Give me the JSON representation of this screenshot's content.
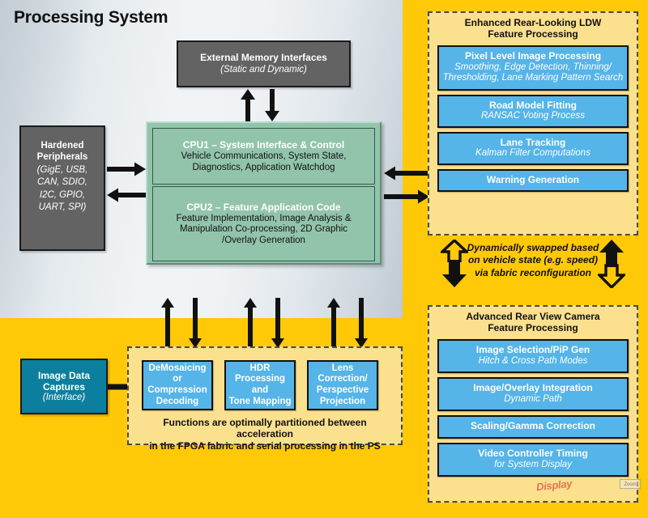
{
  "colors": {
    "accent_yellow": "#ffc907",
    "panel_yellow": "#fbe08d",
    "blue_box": "#55b4e8",
    "teal_box": "#0d7f9e",
    "grey_box": "#636363",
    "cpu_green": "#92c4ac",
    "ps_grey_dark": "#c2ccd5",
    "ps_grey_light": "#f1f4f6"
  },
  "processing_system": {
    "title": "Processing System",
    "external_memory": {
      "title": "External Memory Interfaces",
      "subtitle": "(Static and Dynamic)"
    },
    "hardened_peripherals": {
      "title_line1": "Hardened",
      "title_line2": "Peripherals",
      "subtitle_line1": "(GigE, USB,",
      "subtitle_line2": "CAN, SDIO,",
      "subtitle_line3": "I2C, GPIO,",
      "subtitle_line4": "UART, SPI)"
    },
    "cpu1": {
      "title": "CPU1 – System Interface & Control",
      "detail_line1": "Vehicle Communications, System State,",
      "detail_line2": "Diagnostics, Application Watchdog"
    },
    "cpu2": {
      "title": "CPU2 – Feature Application Code",
      "detail_line1": "Feature Implementation, Image Analysis &",
      "detail_line2": "Manipulation Co-processing, 2D Graphic",
      "detail_line3": "/Overlay Generation"
    }
  },
  "ldw_panel": {
    "title_line1": "Enhanced Rear-Looking LDW",
    "title_line2": "Feature Processing",
    "blocks": [
      {
        "title": "Pixel Level Image Processing",
        "subtitle_line1": "Smoothing, Edge Detection, Thinning/",
        "subtitle_line2": "Thresholding, Lane Marking Pattern Search"
      },
      {
        "title": "Road Model Fitting",
        "subtitle_line1": "RANSAC Voting Process",
        "subtitle_line2": ""
      },
      {
        "title": "Lane Tracking",
        "subtitle_line1": "Kalman Filter Computations",
        "subtitle_line2": ""
      },
      {
        "title": "Warning Generation",
        "subtitle_line1": "",
        "subtitle_line2": ""
      }
    ]
  },
  "swap_note": {
    "line1": "Dynamically swapped based",
    "line2": "on vehicle state (e.g. speed)",
    "line3": "via fabric reconfiguration"
  },
  "rvc_panel": {
    "title_line1": "Advanced Rear View Camera",
    "title_line2": "Feature Processing",
    "blocks": [
      {
        "title": "Image Selection/PiP Gen",
        "subtitle": "Hitch & Cross Path Modes"
      },
      {
        "title": "Image/Overlay Integration",
        "subtitle": "Dynamic Path"
      },
      {
        "title": "Scaling/Gamma Correction",
        "subtitle": ""
      },
      {
        "title": "Video Controller Timing",
        "subtitle": "for System Display"
      }
    ]
  },
  "fpga_panel": {
    "functions": [
      {
        "line1": "DeMosaicing or",
        "line2": "Compression",
        "line3": "Decoding"
      },
      {
        "line1": "HDR",
        "line2": "Processing and",
        "line3": "Tone Mapping"
      },
      {
        "line1": "Lens Correction/",
        "line2": "Perspective",
        "line3": "Projection"
      }
    ],
    "note_line1": "Functions are optimally partitioned between acceleration",
    "note_line2": "in the FPGA fabric and serial processing in the PS"
  },
  "image_capture": {
    "title_line1": "Image Data",
    "title_line2": "Captures",
    "subtitle": "(Interface)"
  },
  "watermark": {
    "text": "Display",
    "badge": "Zoom"
  }
}
